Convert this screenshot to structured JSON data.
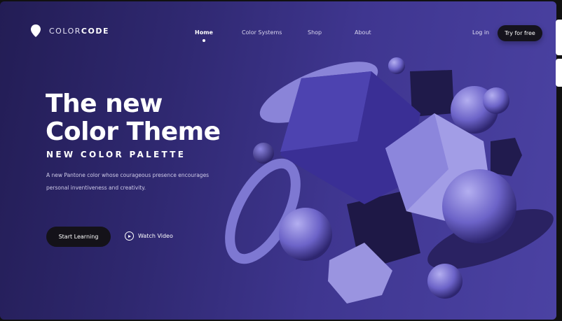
{
  "brand": {
    "name_light": "COLOR",
    "name_bold": "CODE",
    "icon": "location-pin-icon"
  },
  "nav": {
    "items": [
      {
        "label": "Home",
        "active": true
      },
      {
        "label": "Color Systems"
      },
      {
        "label": "Shop"
      },
      {
        "label": "About"
      }
    ],
    "login": "Log in",
    "cta": "Try for free"
  },
  "hero": {
    "title_line1": "The new",
    "title_line2": "Color Theme",
    "subtitle": "NEW COLOR PALETTE",
    "description_line1": "A new Pantone color whose courageous presence encourages",
    "description_line2": "personal inventiveness and creativity.",
    "primary_button": "Start Learning",
    "secondary_button": "Watch Video",
    "play_icon": "play-circle-icon"
  },
  "colors": {
    "bg_dark": "#231d55",
    "bg_light": "#4b42a3",
    "button": "#141219",
    "shape_light": "#9a94e0",
    "shape_dark": "#2a2260"
  }
}
